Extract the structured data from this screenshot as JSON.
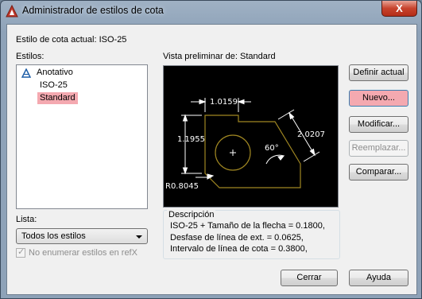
{
  "window": {
    "title": "Administrador de estilos de cota",
    "close_glyph": "X"
  },
  "current_style": {
    "label": "Estilo de cota actual:",
    "value": "ISO-25"
  },
  "styles": {
    "label": "Estilos:",
    "items": [
      {
        "label": "Anotativo",
        "icon": "annotative-icon",
        "selected": false
      },
      {
        "label": "ISO-25",
        "selected": false
      },
      {
        "label": "Standard",
        "selected": true
      }
    ]
  },
  "list_filter": {
    "label": "Lista:",
    "value": "Todos los estilos"
  },
  "xref_option": {
    "label": "No enumerar estilos en refX",
    "checked": true,
    "disabled": true
  },
  "preview": {
    "label": "Vista preliminar de:",
    "style": "Standard",
    "dimensions": [
      "1.0159",
      "1.1955",
      "2.0207",
      "60°",
      "R0.8045"
    ]
  },
  "description": {
    "legend": "Descripción",
    "lines": [
      "ISO-25 + Tamaño de la flecha = 0.1800,",
      "Desfase de línea de ext. = 0.0625,",
      "Intervalo de línea de cota = 0.3800,"
    ]
  },
  "buttons": {
    "set_current": "Definir actual",
    "new": "Nuevo...",
    "modify": "Modificar...",
    "replace": "Reemplazar...",
    "compare": "Comparar...",
    "close": "Cerrar",
    "help": "Ayuda"
  },
  "colors": {
    "selection": "#f4a9b0",
    "preview_bg": "#000000",
    "geometry": "#a08722",
    "dimension": "#ffffff"
  }
}
